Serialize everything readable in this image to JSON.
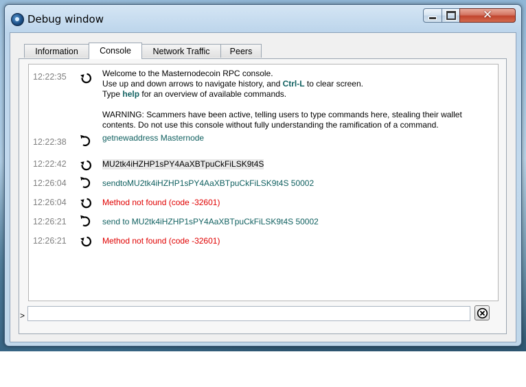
{
  "window": {
    "title": "Debug window",
    "minimize_icon": "minimize-icon",
    "maximize_icon": "maximize-icon",
    "close_icon": "close-icon",
    "close_glyph": "✕"
  },
  "tabs": [
    {
      "label": "Information",
      "active": false
    },
    {
      "label": "Console",
      "active": true
    },
    {
      "label": "Network Traffic",
      "active": false
    },
    {
      "label": "Peers",
      "active": false
    }
  ],
  "console": {
    "welcome": {
      "time": "12:22:35",
      "line1": "Welcome to the Masternodecoin RPC console.",
      "line2_pre": "Use up and down arrows to navigate history, and ",
      "line2_kw": "Ctrl-L",
      "line2_post": " to clear screen.",
      "line3_pre": "Type ",
      "line3_kw": "help",
      "line3_post": " for an overview of available commands.",
      "warning": "WARNING: Scammers have been active, telling users to type commands here, stealing their wallet contents. Do not use this console without fully understanding the ramification of a command."
    },
    "entries": [
      {
        "time": "12:22:38",
        "kind": "request",
        "text": "getnewaddress Masternode"
      },
      {
        "time": "12:22:42",
        "kind": "reply",
        "text": "MU2tk4iHZHP1sPY4AaXBTpuCkFiLSK9t4S"
      },
      {
        "time": "12:26:04",
        "kind": "request",
        "text": "sendtoMU2tk4iHZHP1sPY4AaXBTpuCkFiLSK9t4S 50002"
      },
      {
        "time": "12:26:04",
        "kind": "error",
        "text": "Method not found (code -32601)"
      },
      {
        "time": "12:26:21",
        "kind": "request",
        "text": "send to MU2tk4iHZHP1sPY4AaXBTpuCkFiLSK9t4S 50002"
      },
      {
        "time": "12:26:21",
        "kind": "error",
        "text": "Method not found (code -32601)"
      }
    ],
    "prompt": ">",
    "input_value": "",
    "input_placeholder": "",
    "clear_icon": "clear-console-icon"
  },
  "colors": {
    "request": "#106060",
    "error": "#e00000",
    "timestamp": "#808080"
  }
}
